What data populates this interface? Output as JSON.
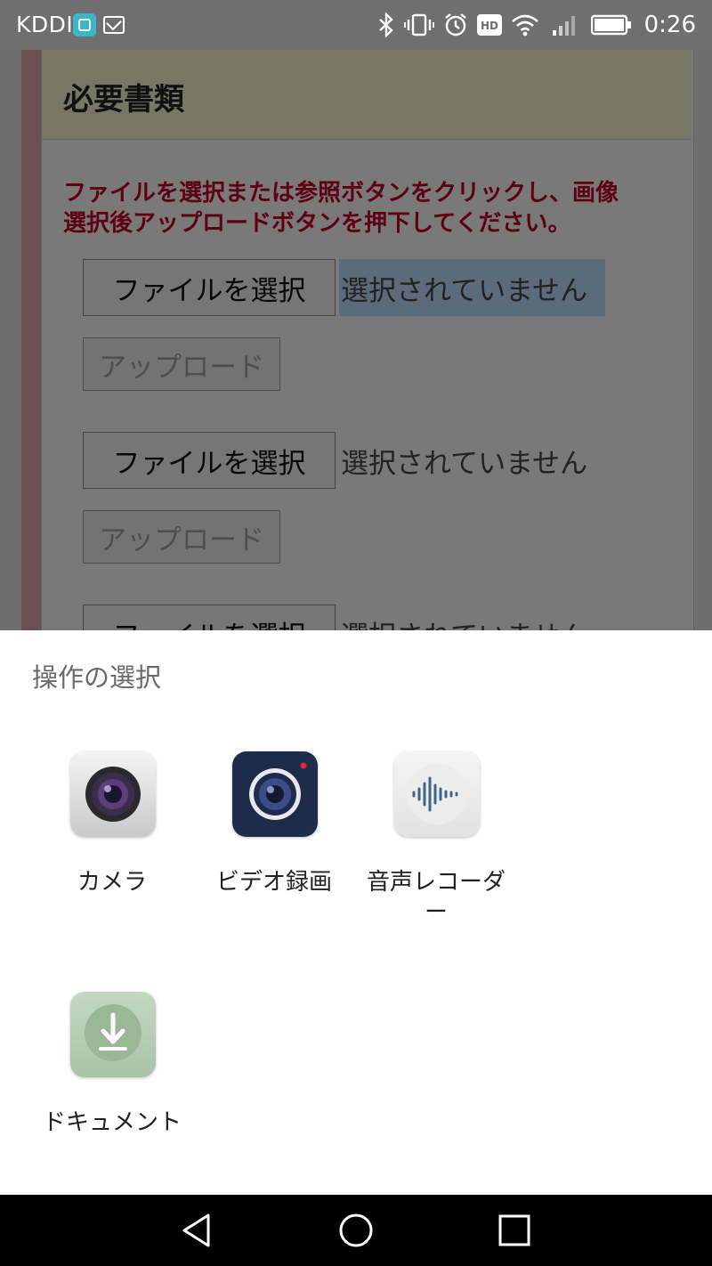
{
  "status_bar": {
    "carrier": "KDDI",
    "time": "0:26",
    "icons": [
      "app-notification-icon",
      "mail-icon",
      "bluetooth-icon",
      "vibrate-icon",
      "alarm-icon",
      "hd-icon",
      "wifi-icon",
      "signal-icon",
      "battery-icon"
    ],
    "hd_label": "HD"
  },
  "page": {
    "section_title": "必要書類",
    "instruction_line1": "ファイルを選択または参照ボタンをクリックし、画像",
    "instruction_line2": "選択後アップロードボタンを押下してください。",
    "upload_rows": [
      {
        "choose_label": "ファイルを選択",
        "status": "選択されていません",
        "upload_label": "アップロード"
      },
      {
        "choose_label": "ファイルを選択",
        "status": "選択されていません",
        "upload_label": "アップロード"
      },
      {
        "choose_label": "ファイルを選択",
        "status": "選択されていません"
      }
    ]
  },
  "chooser": {
    "title": "操作の選択",
    "options": [
      {
        "label": "カメラ",
        "icon": "camera-icon"
      },
      {
        "label": "ビデオ録画",
        "icon": "video-camera-icon"
      },
      {
        "label": "音声レコーダ",
        "label_cont": "ー",
        "icon": "voice-recorder-icon"
      },
      {
        "label": "ドキュメント",
        "icon": "document-download-icon"
      }
    ]
  },
  "nav_bar": {
    "buttons": [
      "back-icon",
      "home-icon",
      "recents-icon"
    ]
  },
  "colors": {
    "instruction_red": "#c1002b",
    "header_bg": "#eeeecb",
    "selected_highlight": "#b9d6f7",
    "video_icon_bg": "#1f2b4b"
  }
}
